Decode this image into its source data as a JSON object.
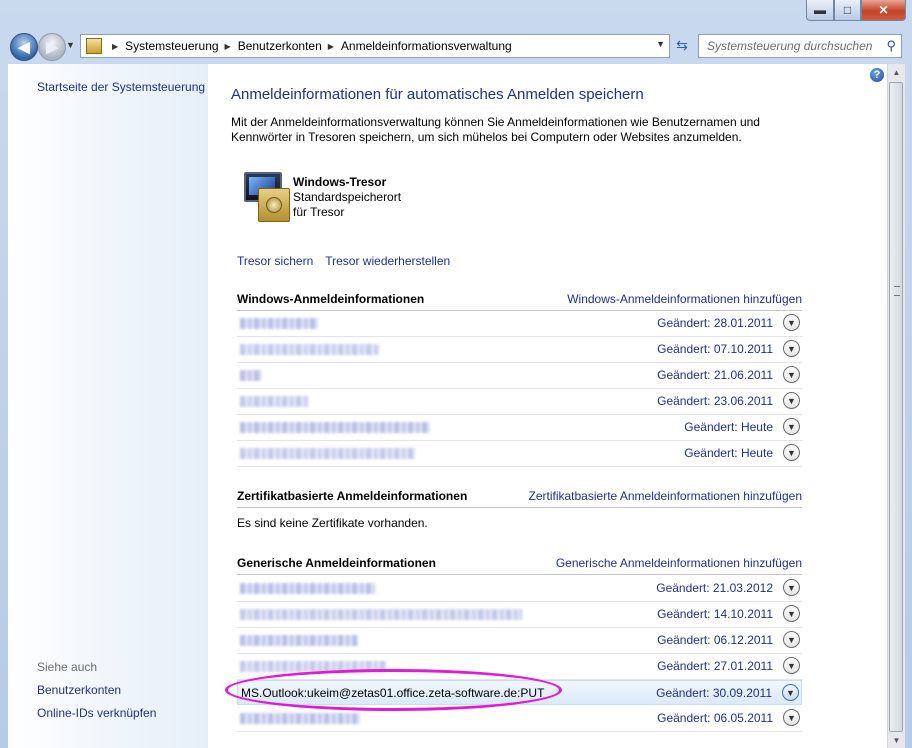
{
  "window": {
    "minimize_glyph": "▬",
    "maximize_glyph": "□",
    "close_glyph": "✕"
  },
  "address_bar": {
    "breadcrumbs": [
      "Systemsteuerung",
      "Benutzerkonten",
      "Anmeldeinformationsverwaltung"
    ],
    "search_placeholder": "Systemsteuerung durchsuchen"
  },
  "sidebar": {
    "home_link": "Startseite der Systemsteuerung",
    "see_also_label": "Siehe auch",
    "see_also_links": [
      "Benutzerkonten",
      "Online-IDs verknüpfen"
    ]
  },
  "main": {
    "title": "Anmeldeinformationen für automatisches Anmelden speichern",
    "description": "Mit der Anmeldeinformationsverwaltung können Sie Anmeldeinformationen wie Benutzernamen und Kennwörter in Tresoren speichern, um sich mühelos bei Computern oder Websites anzumelden.",
    "vault": {
      "name": "Windows-Tresor",
      "subtitle": "Standardspeicherort für Tresor"
    },
    "actions": {
      "backup": "Tresor sichern",
      "restore": "Tresor wiederherstellen"
    },
    "windows_credentials": {
      "heading": "Windows-Anmeldeinformationen",
      "add_link": "Windows-Anmeldeinformationen hinzufügen",
      "items": [
        {
          "date": "Geändert:  28.01.2011"
        },
        {
          "date": "Geändert:  07.10.2011"
        },
        {
          "date": "Geändert:  21.06.2011"
        },
        {
          "date": "Geändert:  23.06.2011"
        },
        {
          "date": "Geändert:  Heute"
        },
        {
          "date": "Geändert:  Heute"
        }
      ]
    },
    "certificate_credentials": {
      "heading": "Zertifikatbasierte Anmeldeinformationen",
      "add_link": "Zertifikatbasierte Anmeldeinformationen hinzufügen",
      "empty_text": "Es sind keine Zertifikate vorhanden."
    },
    "generic_credentials": {
      "heading": "Generische Anmeldeinformationen",
      "add_link": "Generische Anmeldeinformationen hinzufügen",
      "items": [
        {
          "name": "",
          "date": "Geändert:  21.03.2012"
        },
        {
          "name": "",
          "date": "Geändert:  14.10.2011"
        },
        {
          "name": "",
          "date": "Geändert:  06.12.2011"
        },
        {
          "name": "",
          "date": "Geändert:  27.01.2011"
        },
        {
          "name": "MS.Outlook:ukeim@zetas01.office.zeta-software.de:PUT",
          "date": "Geändert:  30.09.2011"
        },
        {
          "name": "",
          "date": "Geändert:  06.05.2011"
        }
      ]
    }
  }
}
